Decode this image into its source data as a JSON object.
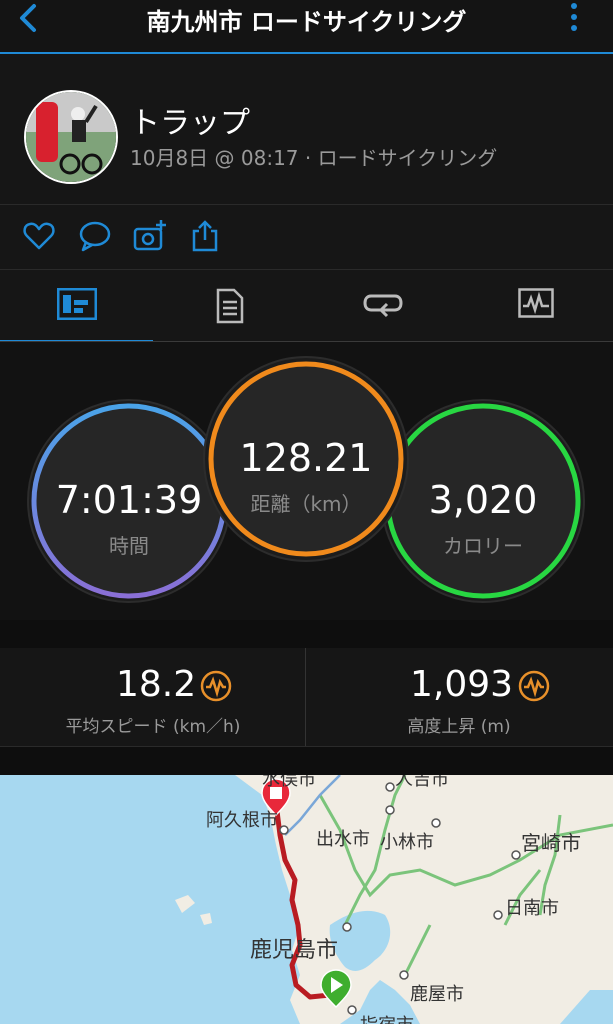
{
  "header": {
    "title": "南九州市 ロードサイクリング"
  },
  "activity": {
    "user_name": "トラップ",
    "meta": "10月8日 @ 08:17 · ロードサイクリング"
  },
  "actions": [
    "like-icon",
    "comment-icon",
    "add-photo-icon",
    "share-icon"
  ],
  "tabs": [
    {
      "icon": "summary-icon",
      "active": true
    },
    {
      "icon": "details-icon",
      "active": false
    },
    {
      "icon": "laps-icon",
      "active": false
    },
    {
      "icon": "graph-icon",
      "active": false
    }
  ],
  "rings": {
    "time": {
      "value": "7:01:39",
      "label": "時間",
      "color": "#6b7fe0"
    },
    "distance": {
      "value": "128.21",
      "label": "距離（km）",
      "color": "#f08a1c"
    },
    "calories": {
      "value": "3,020",
      "label": "カロリー",
      "color": "#28d742"
    }
  },
  "stats": {
    "avg_speed": {
      "value": "18.2",
      "label": "平均スピード (km／h)"
    },
    "elevation_gain": {
      "value": "1,093",
      "label": "高度上昇 (m)"
    }
  },
  "map": {
    "labels": {
      "akune": "阿久根市",
      "izumi": "出水市",
      "kobayashi": "小林市",
      "miyazaki": "宮崎市",
      "nichinan": "日南市",
      "kagoshima": "鹿児島市",
      "kanoya": "鹿屋市",
      "top_left": "水俣市",
      "top_mid": "人吉市",
      "bottom": "指宿市"
    }
  }
}
